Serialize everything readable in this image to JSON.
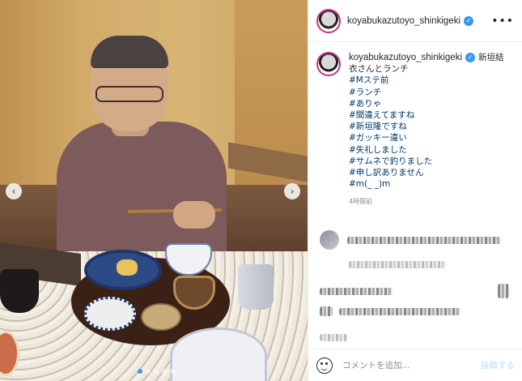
{
  "header": {
    "username": "koyabukazutoyo_shinkigeki",
    "verified_icon": "verified-badge-icon",
    "more_icon": "more-options-icon"
  },
  "caption": {
    "username": "koyabukazutoyo_shinkigeki",
    "lines": [
      "新垣結",
      "衣さんとランチ",
      "#Mステ前",
      "#ランチ",
      "#ありゃ",
      "#間違えてますね",
      "#新垣隆ですね",
      "#ガッキー違い",
      "#失礼しました",
      "#サムネで釣りました",
      "#申し訳ありません",
      "#m(_ _)m"
    ],
    "timestamp": "4時間前"
  },
  "footer": {
    "placeholder": "コメントを追加...",
    "post_label": "投稿する"
  },
  "carousel": {
    "prev_label": "‹",
    "next_label": "›",
    "dots_count": 5,
    "active_dot": 0
  },
  "colors": {
    "accent": "#3897f0",
    "hashtag": "#00376b",
    "post_disabled": "#b2dffc"
  }
}
